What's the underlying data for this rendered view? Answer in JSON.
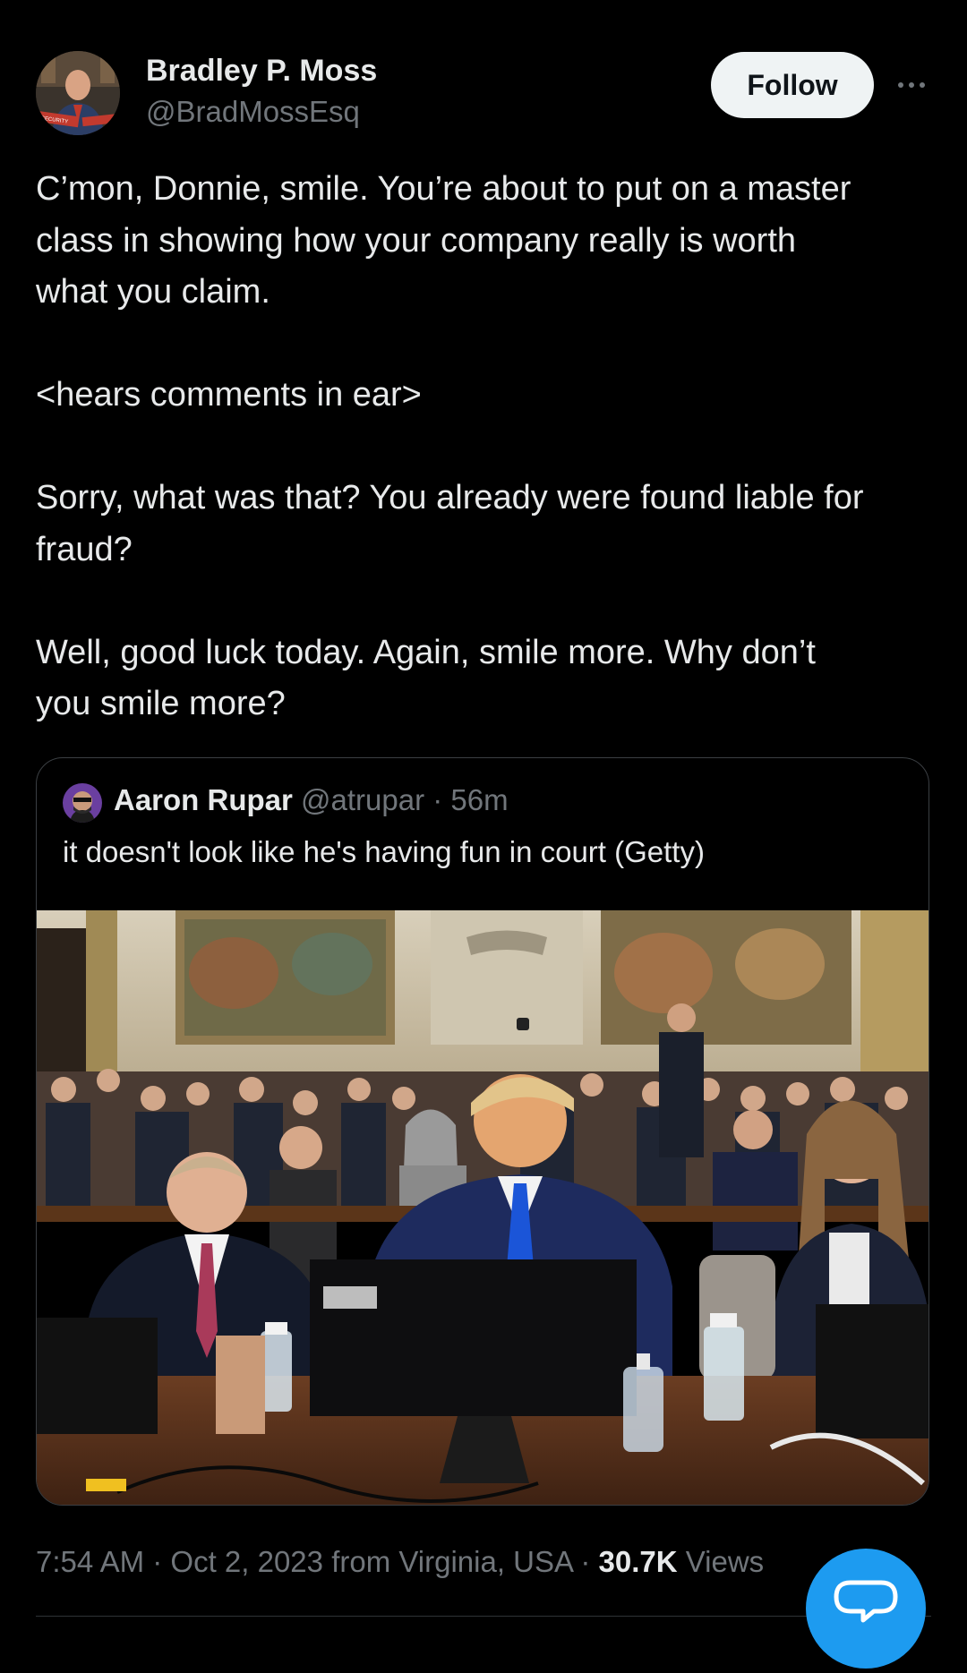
{
  "author": {
    "name": "Bradley P. Moss",
    "handle": "@BradMossEsq",
    "avatar_badge_text": "SECURITY"
  },
  "actions": {
    "follow_label": "Follow",
    "more_icon": "more-horizontal-icon"
  },
  "tweet": {
    "paragraphs": [
      [
        "C’mon, Donnie, smile. You’re about to put on a master",
        "class in showing how your company really is worth",
        "what you claim."
      ],
      [
        "<hears comments in ear>"
      ],
      [
        "Sorry, what was that? You already were found liable for",
        "fraud?"
      ],
      [
        "Well, good luck today. Again, smile more. Why don’t",
        "you smile more?"
      ]
    ]
  },
  "quote": {
    "name": "Aaron Rupar",
    "handle": "@atrupar",
    "time": "56m",
    "meta_separator": " · ",
    "text": "it doesn't look like he's having fun in court (Getty)"
  },
  "footer": {
    "time": "7:54 AM",
    "date": "Oct 2, 2023",
    "location": "from Virginia, USA",
    "views_count": "30.7K",
    "views_label": "Views",
    "separator": " · "
  },
  "fab_icon": "reply-bubble-icon",
  "colors": {
    "background": "#000000",
    "text_primary": "#e7e9ea",
    "text_secondary": "#71767b",
    "accent": "#1d9bf0",
    "follow_bg": "#eff3f4"
  }
}
